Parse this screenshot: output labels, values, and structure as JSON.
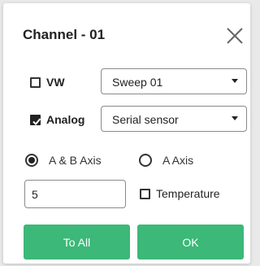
{
  "dialog": {
    "title": "Channel - 01",
    "close_icon": "close-icon"
  },
  "vw": {
    "label": "VW",
    "checked": false,
    "select_value": "Sweep 01"
  },
  "analog": {
    "label": "Analog",
    "checked": true,
    "select_value": "Serial sensor"
  },
  "axis": {
    "options": [
      {
        "label": "A & B Axis",
        "selected": true
      },
      {
        "label": "A Axis",
        "selected": false
      }
    ]
  },
  "value_input": {
    "value": "5"
  },
  "temperature": {
    "label": "Temperature",
    "checked": false
  },
  "buttons": {
    "to_all": "To All",
    "ok": "OK"
  },
  "colors": {
    "accent": "#3cb878",
    "text": "#222222",
    "background": "#ffffff",
    "backdrop": "#e9e9e9"
  }
}
